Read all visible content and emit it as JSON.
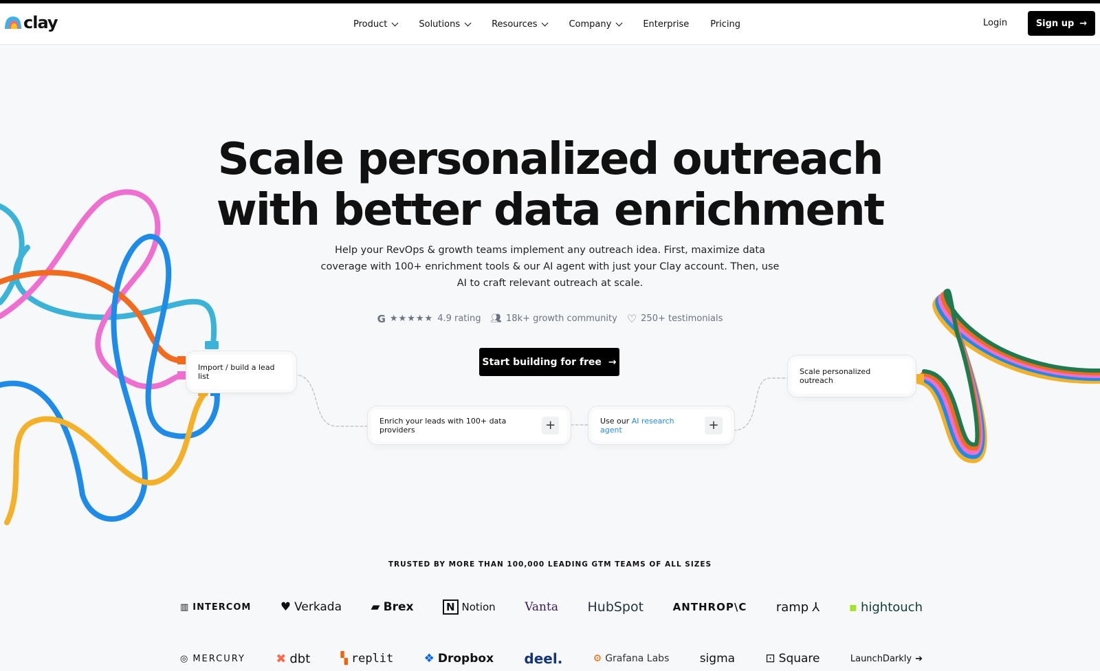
{
  "header": {
    "logo_text": "clay",
    "nav": [
      {
        "label": "Product",
        "dropdown": true
      },
      {
        "label": "Solutions",
        "dropdown": true
      },
      {
        "label": "Resources",
        "dropdown": true
      },
      {
        "label": "Company",
        "dropdown": true
      },
      {
        "label": "Enterprise",
        "dropdown": false
      },
      {
        "label": "Pricing",
        "dropdown": false
      }
    ],
    "login": "Login",
    "signup": "Sign up"
  },
  "hero": {
    "title_line1": "Scale personalized outreach",
    "title_line2": "with better data enrichment",
    "subtitle": "Help your RevOps & growth teams implement any outreach idea. First, maximize data coverage with 100+ enrichment tools & our AI agent with just your Clay account. Then, use AI to craft relevant outreach at scale.",
    "rating": "4.9 rating",
    "stars": 5,
    "community": "18k+ growth community",
    "testimonials": "250+ testimonials",
    "cta": "Start building for free"
  },
  "flow": {
    "step1": "Import / build a lead list",
    "step2": "Enrich your leads with 100+ data providers",
    "step3_prefix": "Use our",
    "step3_link": "AI research agent",
    "step4": "Scale personalized outreach"
  },
  "trusted": {
    "heading": "TRUSTED BY MORE THAN 100,000 LEADING GTM TEAMS OF ALL SIZES",
    "row1": [
      "INTERCOM",
      "Verkada",
      "Brex",
      "Notion",
      "Vanta",
      "HubSpot",
      "ANTHROP\\C",
      "ramp",
      "hightouch"
    ],
    "row2": [
      "MERCURY",
      "dbt",
      "replit",
      "Dropbox",
      "deel.",
      "Grafana Labs",
      "sigma",
      "Square",
      "LaunchDarkly"
    ]
  },
  "colors": {
    "accent_blue": "#1d8cf8",
    "wire_pink": "#ee6fcf",
    "wire_cyan": "#3bb3d9",
    "wire_orange": "#f26a1b",
    "wire_blue": "#1f8be8",
    "wire_yellow": "#f4b027",
    "wire_green": "#1f7a4f"
  }
}
